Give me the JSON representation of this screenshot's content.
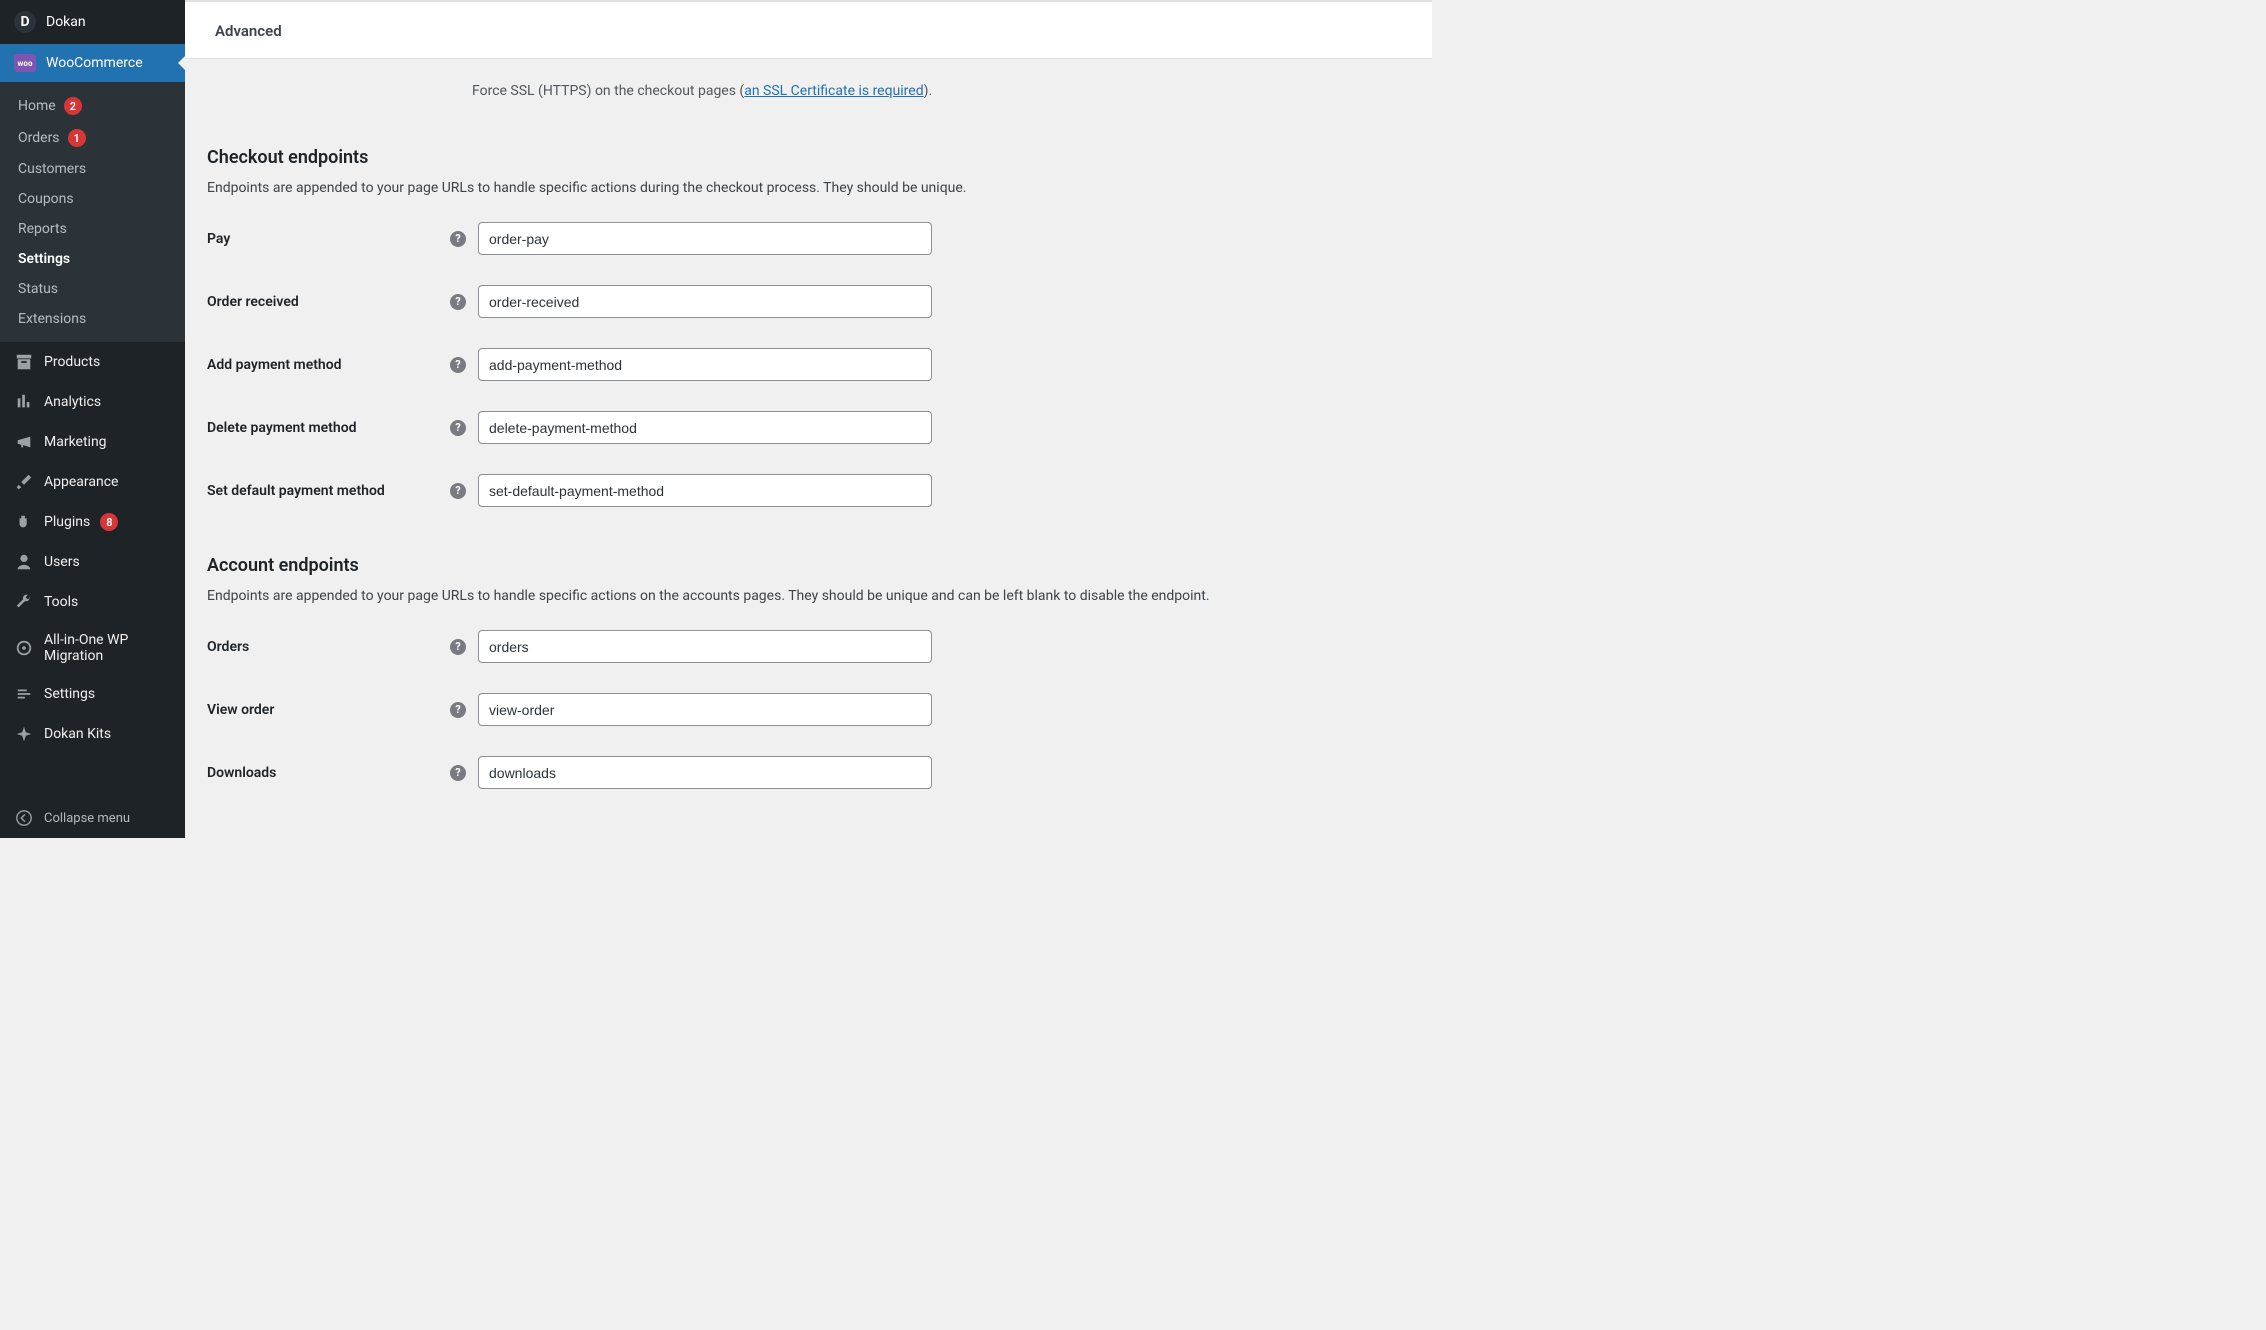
{
  "sidebar": {
    "top_label": "Dokan",
    "active_label": "WooCommerce",
    "submenu": [
      {
        "label": "Home",
        "badge": "2"
      },
      {
        "label": "Orders",
        "badge": "1"
      },
      {
        "label": "Customers"
      },
      {
        "label": "Coupons"
      },
      {
        "label": "Reports"
      },
      {
        "label": "Settings",
        "current": true
      },
      {
        "label": "Status"
      },
      {
        "label": "Extensions"
      }
    ],
    "items": [
      {
        "label": "Products"
      },
      {
        "label": "Analytics"
      },
      {
        "label": "Marketing"
      },
      {
        "label": "Appearance"
      },
      {
        "label": "Plugins",
        "badge": "8"
      },
      {
        "label": "Users"
      },
      {
        "label": "Tools"
      },
      {
        "label": "All-in-One WP Migration"
      },
      {
        "label": "Settings"
      },
      {
        "label": "Dokan Kits"
      }
    ],
    "collapse": "Collapse menu"
  },
  "header": {
    "tab": "Advanced"
  },
  "ssl": {
    "prefix": "Force SSL (HTTPS) on the checkout pages (",
    "link": "an SSL Certificate is required",
    "suffix": ")."
  },
  "sections": {
    "checkout": {
      "title": "Checkout endpoints",
      "desc": "Endpoints are appended to your page URLs to handle specific actions during the checkout process. They should be unique.",
      "rows": [
        {
          "label": "Pay",
          "value": "order-pay"
        },
        {
          "label": "Order received",
          "value": "order-received"
        },
        {
          "label": "Add payment method",
          "value": "add-payment-method"
        },
        {
          "label": "Delete payment method",
          "value": "delete-payment-method"
        },
        {
          "label": "Set default payment method",
          "value": "set-default-payment-method"
        }
      ]
    },
    "account": {
      "title": "Account endpoints",
      "desc": "Endpoints are appended to your page URLs to handle specific actions on the accounts pages. They should be unique and can be left blank to disable the endpoint.",
      "rows": [
        {
          "label": "Orders",
          "value": "orders"
        },
        {
          "label": "View order",
          "value": "view-order"
        },
        {
          "label": "Downloads",
          "value": "downloads"
        }
      ]
    }
  }
}
